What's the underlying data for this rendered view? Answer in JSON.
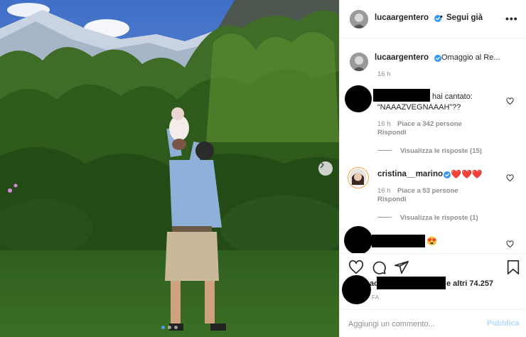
{
  "post": {
    "author": "lucaargentero",
    "follow_label": "Segui già",
    "carousel_dots": 3,
    "active_dot": 0
  },
  "caption": {
    "author": "lucaargentero",
    "text": "Omaggio al Re...",
    "time": "16 h"
  },
  "comments": [
    {
      "author_redacted": true,
      "text_line1": "hai cantato:",
      "text_line2": "“NAAAZVEGNAAAH”??",
      "time": "16 h",
      "likes": "Piace a 342 persone",
      "reply": "Rispondi",
      "thread": "Visualizza le risposte (15)"
    },
    {
      "author": "cristina__marino",
      "text": "❤️❤️❤️",
      "time": "16 h",
      "likes": "Piace a 53 persone",
      "reply": "Rispondi",
      "thread": "Visualizza le risposte (1)"
    },
    {
      "author_redacted": true,
      "text": "😍"
    }
  ],
  "likes_summary": {
    "prefix": "ac",
    "suffix": "e altri 74.257",
    "ago": "FA"
  },
  "add_comment": {
    "placeholder": "Aggiungi un commento...",
    "publish": "Pubblica"
  },
  "colors": {
    "verified": "#3897f0",
    "publish_disabled": "#b3dbff",
    "secondary_text": "#8e8e8e",
    "carousel_active": "#4aa3f0"
  },
  "icons": [
    "verified-badge-icon",
    "more-options-icon",
    "heart-icon",
    "comment-icon",
    "share-icon",
    "bookmark-icon",
    "chevron-right-icon"
  ]
}
